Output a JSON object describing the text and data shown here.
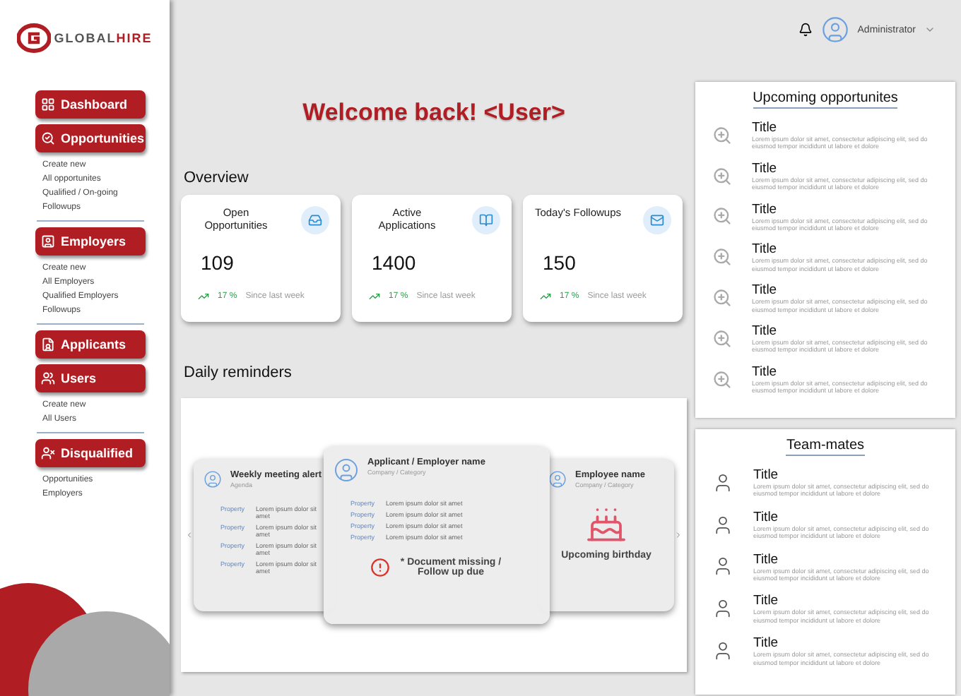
{
  "brand": {
    "part1": "GLOBAL",
    "part2": "HIRE"
  },
  "nav": [
    {
      "label": "Dashboard",
      "kind": "grid"
    },
    {
      "label": "Opportunities",
      "kind": "search",
      "subitems": [
        "Create new",
        "All opportunites",
        "Qualified / On-going",
        "Followups"
      ]
    },
    {
      "label": "Employers",
      "kind": "person-desk",
      "subitems": [
        "Create new",
        "All Employers",
        "Qualified Employers",
        "Followups"
      ]
    },
    {
      "label": "Applicants",
      "kind": "document"
    },
    {
      "label": "Users",
      "kind": "group",
      "subitems": [
        "Create new",
        "All Users"
      ]
    },
    {
      "label": "Disqualified",
      "kind": "person-x",
      "subitems": [
        "Opportunities",
        "Employers"
      ]
    }
  ],
  "user": {
    "name": "Administrator"
  },
  "welcome": "Welcome back! <User>",
  "overview": {
    "title": "Overview",
    "cards": [
      {
        "title": "Open Opportunities",
        "value": "109",
        "change": "17 %",
        "note": "Since last week",
        "kind": "inbox"
      },
      {
        "title": "Active Applications",
        "value": "1400",
        "change": "17 %",
        "note": "Since last week",
        "kind": "book"
      },
      {
        "title": "Today's Followups",
        "value": "150",
        "change": "17 %",
        "note": "Since last week",
        "kind": "mail"
      }
    ]
  },
  "reminders": {
    "title": "Daily reminders",
    "cards": [
      {
        "kind": "meeting",
        "title": "Weekly meeting alert",
        "subtitle": "Agenda",
        "rows": [
          {
            "label": "Property",
            "value": "Lorem ipsum dolor sit amet"
          },
          {
            "label": "Property",
            "value": "Lorem ipsum dolor sit amet"
          },
          {
            "label": "Property",
            "value": "Lorem ipsum dolor sit amet"
          },
          {
            "label": "Property",
            "value": "Lorem ipsum dolor sit amet"
          }
        ]
      },
      {
        "kind": "followup",
        "title": "Applicant / Employer name",
        "subtitle": "Company / Category",
        "rows": [
          {
            "label": "Property",
            "value": "Lorem ipsum dolor sit amet"
          },
          {
            "label": "Property",
            "value": "Lorem ipsum dolor sit amet"
          },
          {
            "label": "Property",
            "value": "Lorem ipsum dolor sit amet"
          },
          {
            "label": "Property",
            "value": "Lorem ipsum dolor sit amet"
          }
        ],
        "alert": "* Document missing / Follow up due"
      },
      {
        "kind": "birthday",
        "title": "Employee name",
        "subtitle": "Company / Category",
        "caption": "Upcoming birthday"
      }
    ]
  },
  "upcoming": {
    "title": "Upcoming opportunites",
    "items": [
      {
        "title": "Title",
        "text": "Lorem ipsum dolor sit amet, consectetur adipiscing elit, sed do eiusmod tempor incididunt ut labore et dolore"
      },
      {
        "title": "Title",
        "text": "Lorem ipsum dolor sit amet, consectetur adipiscing elit, sed do eiusmod tempor incididunt ut labore et dolore"
      },
      {
        "title": "Title",
        "text": "Lorem ipsum dolor sit amet, consectetur adipiscing elit, sed do eiusmod tempor incididunt ut labore et dolore"
      },
      {
        "title": "Title",
        "text": "Lorem ipsum dolor sit amet, consectetur adipiscing elit, sed do eiusmod tempor incididunt ut labore et dolore"
      },
      {
        "title": "Title",
        "text": "Lorem ipsum dolor sit amet, consectetur adipiscing elit, sed do eiusmod tempor incididunt ut labore et dolore"
      },
      {
        "title": "Title",
        "text": "Lorem ipsum dolor sit amet, consectetur adipiscing elit, sed do eiusmod tempor incididunt ut labore et dolore"
      },
      {
        "title": "Title",
        "text": "Lorem ipsum dolor sit amet, consectetur adipiscing elit, sed do eiusmod tempor incididunt ut labore et dolore"
      }
    ]
  },
  "teammates": {
    "title": "Team-mates",
    "items": [
      {
        "title": "Title",
        "text": "Lorem ipsum dolor sit amet, consectetur adipiscing elit, sed do eiusmod tempor incididunt ut labore et dolore"
      },
      {
        "title": "Title",
        "text": "Lorem ipsum dolor sit amet, consectetur adipiscing elit, sed do eiusmod tempor incididunt ut labore et dolore"
      },
      {
        "title": "Title",
        "text": "Lorem ipsum dolor sit amet, consectetur adipiscing elit, sed do eiusmod tempor incididunt ut labore et dolore"
      },
      {
        "title": "Title",
        "text": "Lorem ipsum dolor sit amet, consectetur adipiscing elit, sed do eiusmod tempor incididunt ut labore et dolore"
      },
      {
        "title": "Title",
        "text": "Lorem ipsum dolor sit amet, consectetur adipiscing elit, sed do eiusmod tempor incididunt ut labore et dolore"
      }
    ]
  }
}
